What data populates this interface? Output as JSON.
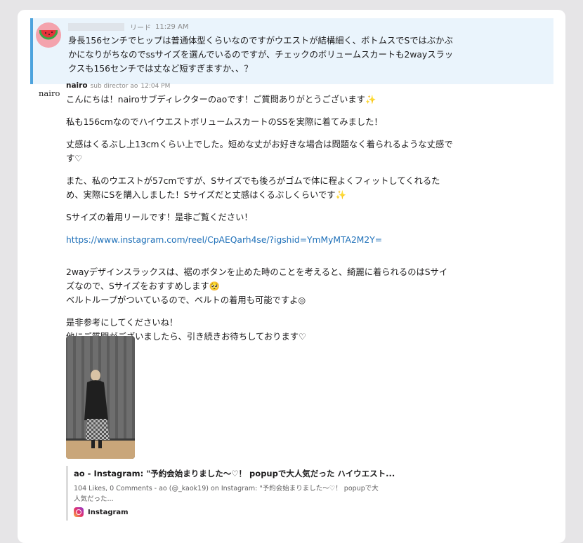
{
  "lead": {
    "tag": "リード",
    "time": "11:29 AM",
    "text_lines": [
      "身長156センチでヒップは普通体型くらいなのですがウエストが結構細く、ボトムスでSではぶかぶ",
      "かになりがちなのでssサイズを選んでいるのですが、チェックのボリュームスカートも2wayスラッ",
      "クスも156センチでは丈など短すぎますか、、？"
    ]
  },
  "reply": {
    "avatar_text": "nairo",
    "name": "nairo",
    "role": "sub director ao",
    "time": "12:04 PM",
    "p1": "こんにちは！nairoサブディレクターのaoです！ご質問ありがとうございます",
    "p2": "私も156cmなのでハイウエストボリュームスカートのSSを実際に着てみました！",
    "p3a": "丈感はくるぶし上13cmくらい上でした。短めな丈がお好きな場合は問題なく着られるような丈感で",
    "p3b": "す♡",
    "p4a": "また、私のウエストが57cmですが、Sサイズでも後ろがゴムで体に程よくフィットしてくれるた",
    "p4b": "め、実際にSを購入しました！Sサイズだと丈感はくるぶしくらいです",
    "p5": "Sサイズの着用リールです！是非ご覧ください！",
    "link": "https://www.instagram.com/reel/CpAEQarh4se/?igshid=YmMyMTA2M2Y=",
    "p6a": "2wayデザインスラックスは、裾のボタンを止めた時のことを考えると、綺麗に着られるのはSサイ",
    "p6b": "ズなので、Sサイズをおすすめします",
    "p6c": "ベルトループがついているので、ベルトの着用も可能ですよ◎",
    "p7a": "是非参考にしてくださいね！",
    "p7b": "他にご質問がございましたら、引き続きお待ちしております♡",
    "sparkle": "✨",
    "emoji_face": "🥺"
  },
  "unfurl": {
    "title": "ao - Instagram: \"予約会始まりました〜♡！ popupで大人気だった ハイウエスト...",
    "desc_line1": "104 Likes, 0 Comments - ao (@_kaok19) on Instagram: \"予約会始まりました〜♡！ popupで大",
    "desc_line2": "人気だった...",
    "source": "Instagram"
  }
}
